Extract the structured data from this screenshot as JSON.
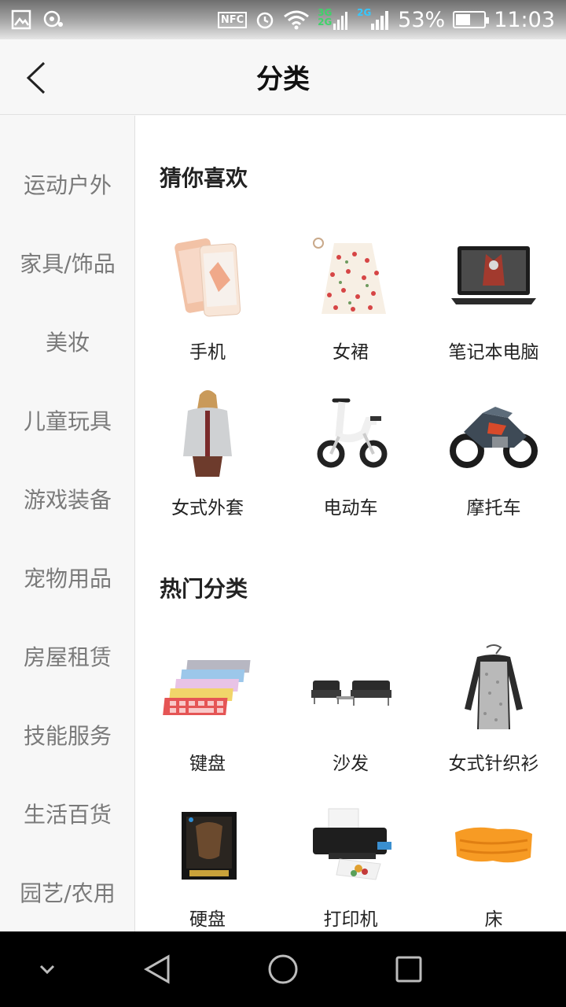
{
  "status_bar": {
    "nfc": "NFC",
    "net_top": "3G",
    "net_bottom": "2G",
    "net2": "2G",
    "battery_text": "53%",
    "battery_level": 0.53,
    "time": "11:03"
  },
  "header": {
    "title": "分类"
  },
  "sidebar": {
    "items": [
      {
        "label": "运动户外"
      },
      {
        "label": "家具/饰品"
      },
      {
        "label": "美妆"
      },
      {
        "label": "儿童玩具"
      },
      {
        "label": "游戏装备"
      },
      {
        "label": "宠物用品"
      },
      {
        "label": "房屋租赁"
      },
      {
        "label": "技能服务"
      },
      {
        "label": "生活百货"
      },
      {
        "label": "园艺/农用"
      }
    ]
  },
  "sections": [
    {
      "title": "猜你喜欢",
      "items": [
        {
          "label": "手机",
          "icon": "phone-icon"
        },
        {
          "label": "女裙",
          "icon": "skirt-icon"
        },
        {
          "label": "笔记本电脑",
          "icon": "laptop-icon"
        },
        {
          "label": "女式外套",
          "icon": "jacket-icon"
        },
        {
          "label": "电动车",
          "icon": "e-scooter-icon"
        },
        {
          "label": "摩托车",
          "icon": "motorcycle-icon"
        }
      ]
    },
    {
      "title": "热门分类",
      "items": [
        {
          "label": "键盘",
          "icon": "keyboard-icon"
        },
        {
          "label": "沙发",
          "icon": "sofa-icon"
        },
        {
          "label": "女式针织衫",
          "icon": "sweater-icon"
        },
        {
          "label": "硬盘",
          "icon": "hard-drive-icon"
        },
        {
          "label": "打印机",
          "icon": "printer-icon"
        },
        {
          "label": "床",
          "icon": "air-bed-icon"
        }
      ]
    }
  ]
}
